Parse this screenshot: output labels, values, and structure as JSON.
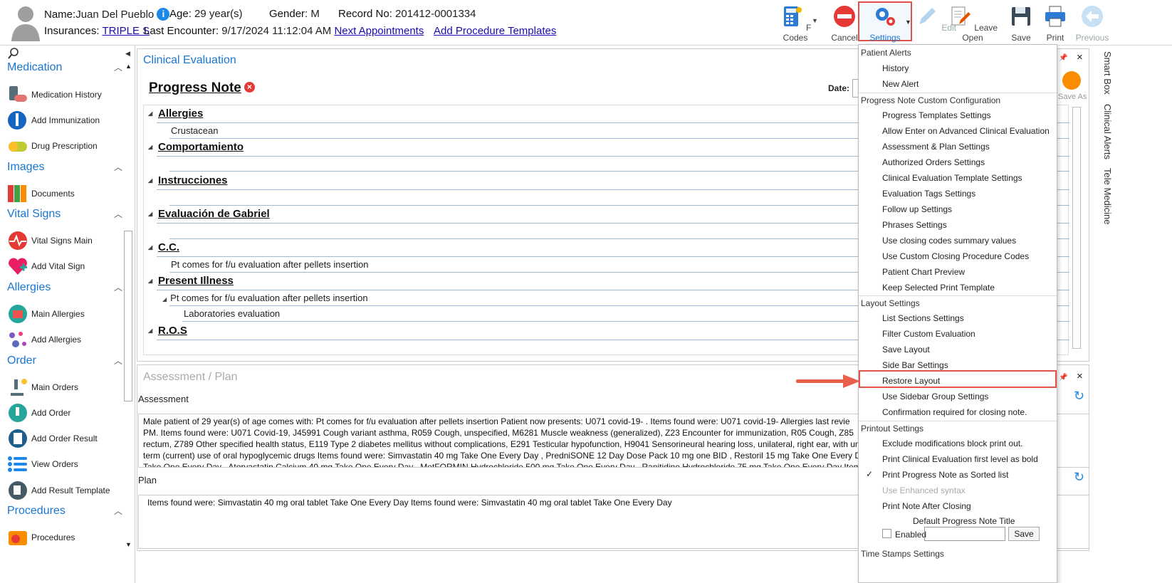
{
  "header": {
    "name_label": "Name:",
    "name": "Juan Del Pueblo",
    "age_label": "Age:",
    "age": "29 year(s)",
    "gender_label": "Gender:",
    "gender": "M",
    "record_label": "Record No:",
    "record": "201412-0001334",
    "ins_label": "Insurances:",
    "ins": "TRIPLE S",
    "last_label": "Last Encounter:",
    "last": "9/17/2024 11:12:04 AM",
    "next": "Next Appointments",
    "addproc": "Add Procedure Templates",
    "info": "i"
  },
  "toolbar": {
    "fcodes": "F Codes",
    "cancel": "Cancel",
    "settings": "Settings",
    "edit": "Edit",
    "leave": "Leave Open",
    "save": "Save",
    "print": "Print",
    "previous": "Previous"
  },
  "sidebar": {
    "medication": "Medication",
    "med_history": "Medication History",
    "add_imm": "Add Immunization",
    "drug": "Drug Prescription",
    "images": "Images",
    "documents": "Documents",
    "vital": "Vital Signs",
    "vital_main": "Vital Signs Main",
    "add_vital": "Add Vital Sign",
    "allergies": "Allergies",
    "main_all": "Main Allergies",
    "add_all": "Add Allergies",
    "order": "Order",
    "main_orders": "Main Orders",
    "add_order": "Add Order",
    "add_result": "Add Order Result",
    "view_orders": "View Orders",
    "add_rt": "Add Result Template",
    "procedures": "Procedures",
    "proc": "Procedures"
  },
  "main": {
    "title": "Clinical Evaluation",
    "pn": "Progress Note",
    "date": "Date:",
    "save_as": "Save As",
    "s1": "Allergies",
    "s1a": "Crustacean",
    "s2": "Comportamiento",
    "s3": "Instrucciones",
    "s4": "Evaluación de Gabriel",
    "s5": "C.C.",
    "s5a": "Pt comes for f/u evaluation after pellets insertion",
    "s6": "Present Illness",
    "s6a": "Pt comes for f/u evaluation after pellets insertion",
    "s6b": "Laboratories evaluation",
    "s7": "R.O.S"
  },
  "ap": {
    "title": "Assessment / Plan",
    "assessment": "Assessment",
    "plan": "Plan",
    "a1": "Male patient of 29 year(s) of age comes with:  Pt comes for f/u evaluation after pellets insertion  Patient now presents:  U071 covid-19- . Items found were:  U071 covid-19-    Allergies last revie",
    "a2": "PM.     Items found were:  U071 Covid-19, J45991 Cough variant asthma, R059 Cough, unspecified, M6281 Muscle weakness (generalized), Z23 Encounter for immunization, R05 Cough, Z85",
    "a3": "rectum, Z789 Other specified health status, E119 Type 2 diabetes mellitus without complications, E291 Testicular hypofunction, H9041 Sensorineural hearing loss, unilateral, right ear, with unre",
    "a4": "term (current) use of oral hypoglycemic drugs  Items found were:  Simvastatin 40 mg Take One Every Day , PredniSONE 12 Day Dose Pack 10 mg one BID , Restoril 15 mg Take One Every D",
    "a5": "Take One Every Day , Atorvastatin Calcium 40 mg Take One Every Day , MetFORMIN Hydrochloride 500 mg Take One Every Day , Ranitidine Hydrochloride 75 mg Take One Every Day   Item",
    "p1": "Items found were:  Simvastatin 40 mg oral tablet Take One Every Day   Items found were:  Simvastatin 40 mg oral tablet Take One Every Day"
  },
  "rightbar": {
    "smart": "Smart Box",
    "alerts": "Clinical Alerts",
    "tele": "Tele Medicine"
  },
  "menu": {
    "h1": "Patient Alerts",
    "i1": "History",
    "i2": "New Alert",
    "h2": "Progress Note Custom Configuration",
    "i3": "Progress Templates Settings",
    "i4": "Allow Enter on Advanced Clinical Evaluation",
    "i5": "Assessment & Plan Settings",
    "i6": "Authorized Orders Settings",
    "i7": "Clinical Evaluation Template Settings",
    "i8": "Evaluation Tags Settings",
    "i9": "Follow up Settings",
    "i10": "Phrases Settings",
    "i11": "Use closing codes summary values",
    "i12": "Use Custom Closing Procedure Codes",
    "i13": "Patient Chart Preview",
    "i14": "Keep Selected Print Template",
    "h3": "Layout Settings",
    "i15": "List Sections Settings",
    "i16": "Filter Custom Evaluation",
    "i17": "Save Layout",
    "i18": "Side Bar Settings",
    "i19": "Restore Layout",
    "i20": "Use Sidebar Group Settings",
    "i21": "Confirmation required for closing note.",
    "h4": "Printout Settings",
    "i22": "Exclude modifications block print out.",
    "i23": "Print Clinical Evaluation first level as bold",
    "i24": "Print Progress Note as Sorted list",
    "i25": "Use Enhanced syntax",
    "i26": "Print Note After Closing",
    "i27": "Default Progress Note Title",
    "i28": "Enabled",
    "i29": "Save",
    "h5": "Time Stamps Settings"
  }
}
